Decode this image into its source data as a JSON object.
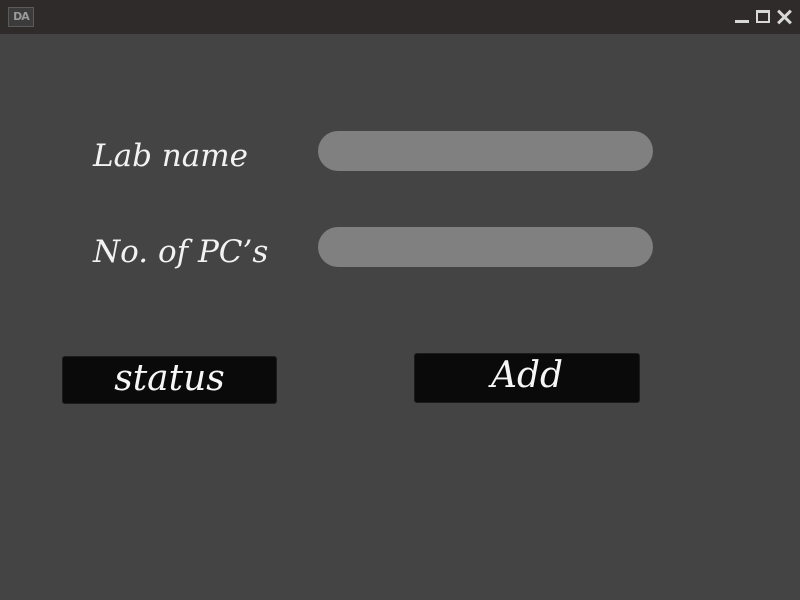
{
  "window": {
    "logo_text": "DA",
    "controls": [
      "minimize-icon",
      "maximize-icon",
      "close-icon"
    ]
  },
  "form": {
    "lab_name_label": "Lab name",
    "lab_name_value": "",
    "pc_count_label": "No. of PC’s",
    "pc_count_value": ""
  },
  "buttons": {
    "status_label": "status",
    "add_label": "Add"
  },
  "colors": {
    "background": "#444444",
    "titlebar": "#2f2b2b",
    "field": "#808080",
    "button": "#0a0a0a",
    "text": "#f2f2f2"
  }
}
